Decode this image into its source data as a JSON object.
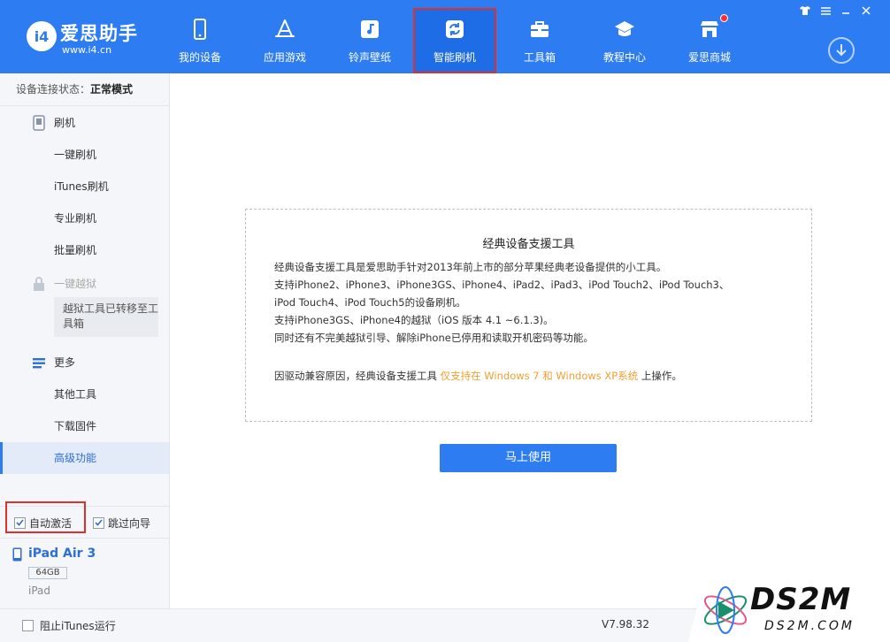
{
  "app": {
    "logo_mark": "i4",
    "logo_name": "爱思助手",
    "logo_url": "www.i4.cn"
  },
  "nav": [
    {
      "label": "我的设备",
      "icon": "phone-icon"
    },
    {
      "label": "应用游戏",
      "icon": "app-store-icon"
    },
    {
      "label": "铃声壁纸",
      "icon": "music-note-icon"
    },
    {
      "label": "智能刷机",
      "icon": "refresh-icon",
      "active": true
    },
    {
      "label": "工具箱",
      "icon": "toolbox-icon"
    },
    {
      "label": "教程中心",
      "icon": "graduation-cap-icon"
    },
    {
      "label": "爱思商城",
      "icon": "shop-icon"
    }
  ],
  "window_controls": [
    "shirt-icon",
    "menu-icon",
    "minimize-icon",
    "close-icon"
  ],
  "sidebar": {
    "status_label": "设备连接状态：",
    "status_value": "正常模式",
    "flash_header": "刷机",
    "flash_items": [
      "一键刷机",
      "iTunes刷机",
      "专业刷机",
      "批量刷机"
    ],
    "jailbreak_header": "一键越狱",
    "jailbreak_note": "越狱工具已转移至工具箱",
    "more_header": "更多",
    "more_items": [
      "其他工具",
      "下载固件",
      "高级功能"
    ],
    "selected_item": "高级功能",
    "auto_activate_label": "自动激活",
    "skip_guide_label": "跳过向导",
    "device_name": "iPad Air 3",
    "device_capacity": "64GB",
    "device_type": "iPad"
  },
  "statusbar": {
    "block_itunes_label": "阻止iTunes运行",
    "version": "V7.98.32"
  },
  "main": {
    "title": "经典设备支援工具",
    "line1": "经典设备支援工具是爱思助手针对2013年前上市的部分苹果经典老设备提供的小工具。",
    "line2": "支持iPhone2、iPhone3、iPhone3GS、iPhone4、iPad2、iPad3、iPod Touch2、iPod Touch3、",
    "line3": "iPod Touch4、iPod Touch5的设备刷机。",
    "line4": "支持iPhone3GS、iPhone4的越狱（iOS 版本 4.1 ~6.1.3)。",
    "line5": "同时还有不完美越狱引导、解除iPhone已停用和读取开机密码等功能。",
    "note_prefix": "因驱动兼容原因，经典设备支援工具 ",
    "note_highlight": "仅支持在 Windows 7 和 Windows XP系统",
    "note_suffix": " 上操作。",
    "button_label": "马上使用"
  },
  "watermark": {
    "text": "DS2M",
    "subtext": "DS2M.COM"
  },
  "colors": {
    "accent": "#2d7cf2",
    "highlight_box": "#e0302d",
    "orange_text": "#f0a030"
  }
}
